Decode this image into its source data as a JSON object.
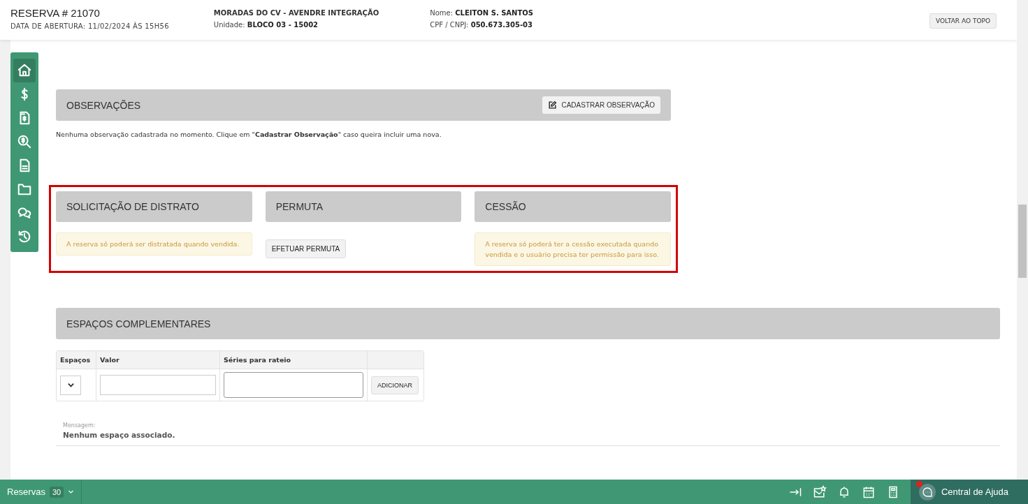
{
  "header": {
    "title": "RESERVA # 21070",
    "opened": "DATA DE ABERTURA: 11/02/2024 ÀS 15H56",
    "project": "MORADAS DO CV - AVENDRE INTEGRAÇÃO",
    "unit_label": "Unidade:",
    "unit": "BLOCO 03 - 15002",
    "name_label": "Nome:",
    "name": "CLEITON S. SANTOS",
    "doc_label": "CPF / CNPJ:",
    "doc": "050.673.305-03",
    "top_button": "VOLTAR AO TOPO"
  },
  "sidebar": {
    "items": [
      {
        "kind": "home",
        "selected": true
      },
      {
        "kind": "dollar",
        "selected": false
      },
      {
        "kind": "invoice",
        "selected": false
      },
      {
        "kind": "search-money",
        "selected": false
      },
      {
        "kind": "document",
        "selected": false
      },
      {
        "kind": "folder",
        "selected": false
      },
      {
        "kind": "chat",
        "selected": false
      },
      {
        "kind": "history",
        "selected": false
      }
    ]
  },
  "observations": {
    "title": "OBSERVAÇÕES",
    "button": "CADASTRAR OBSERVAÇÃO",
    "message": "Nenhuma observação cadastrada no momento. Clique em \"**Cadastrar Observação**\" caso queira incluir uma nova."
  },
  "actions": [
    {
      "title": "SOLICITAÇÃO DE DISTRATO",
      "kind": "alert",
      "text": "A reserva só poderá ser distratada quando vendida."
    },
    {
      "title": "PERMUTA",
      "kind": "button",
      "text": "EFETUAR PERMUTA"
    },
    {
      "title": "CESSÃO",
      "kind": "alert",
      "text": "A reserva só poderá ter a cessão executada quando vendida e o usuário precisa ter permissão para isso."
    }
  ],
  "spaces": {
    "title": "ESPAÇOS COMPLEMENTARES",
    "columns": [
      "Espaços",
      "Valor",
      "Séries para rateio"
    ],
    "button": "ADICIONAR",
    "message_label": "Mensagem:",
    "message": "Nenhum espaço associado."
  },
  "status_bar": {
    "reservations_label": "Reservas",
    "count": "30",
    "help": "Central de Ajuda",
    "notification": true
  }
}
